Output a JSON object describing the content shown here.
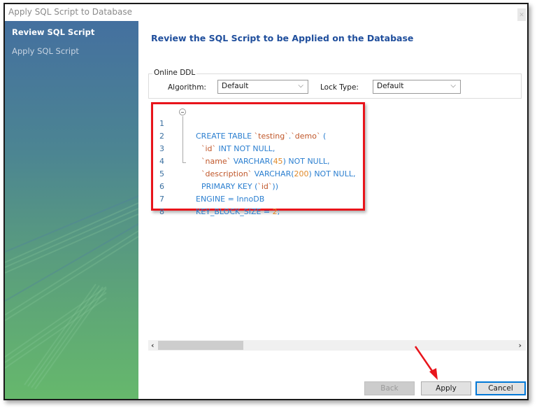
{
  "window": {
    "title": "Apply SQL Script to Database",
    "close_icon": "close-icon"
  },
  "sidebar": {
    "items": [
      {
        "label": "Review SQL Script",
        "active": true
      },
      {
        "label": "Apply SQL Script",
        "active": false
      }
    ]
  },
  "main": {
    "heading": "Review the SQL Script to be Applied on the Database",
    "online_ddl": {
      "legend": "Online DDL",
      "algorithm_label": "Algorithm:",
      "algorithm_value": "Default",
      "lock_type_label": "Lock Type:",
      "lock_type_value": "Default"
    },
    "editor": {
      "lines": [
        {
          "num": "1",
          "text": "CREATE TABLE `testing`.`demo` ("
        },
        {
          "num": "2",
          "text": "`id` INT NOT NULL,"
        },
        {
          "num": "3",
          "text": "`name` VARCHAR(45) NOT NULL,"
        },
        {
          "num": "4",
          "text": "`description` VARCHAR(200) NOT NULL,"
        },
        {
          "num": "5",
          "text": "PRIMARY KEY (`id`))"
        },
        {
          "num": "6",
          "text": "ENGINE = InnoDB"
        },
        {
          "num": "7",
          "text": "KEY_BLOCK_SIZE = 2;"
        },
        {
          "num": "8",
          "text": ""
        }
      ]
    },
    "scrollbar": {
      "left_arrow": "‹",
      "right_arrow": "›"
    }
  },
  "buttons": {
    "back": "Back",
    "apply": "Apply",
    "cancel": "Cancel"
  },
  "annotation": {
    "highlight_color": "#e8141b"
  }
}
